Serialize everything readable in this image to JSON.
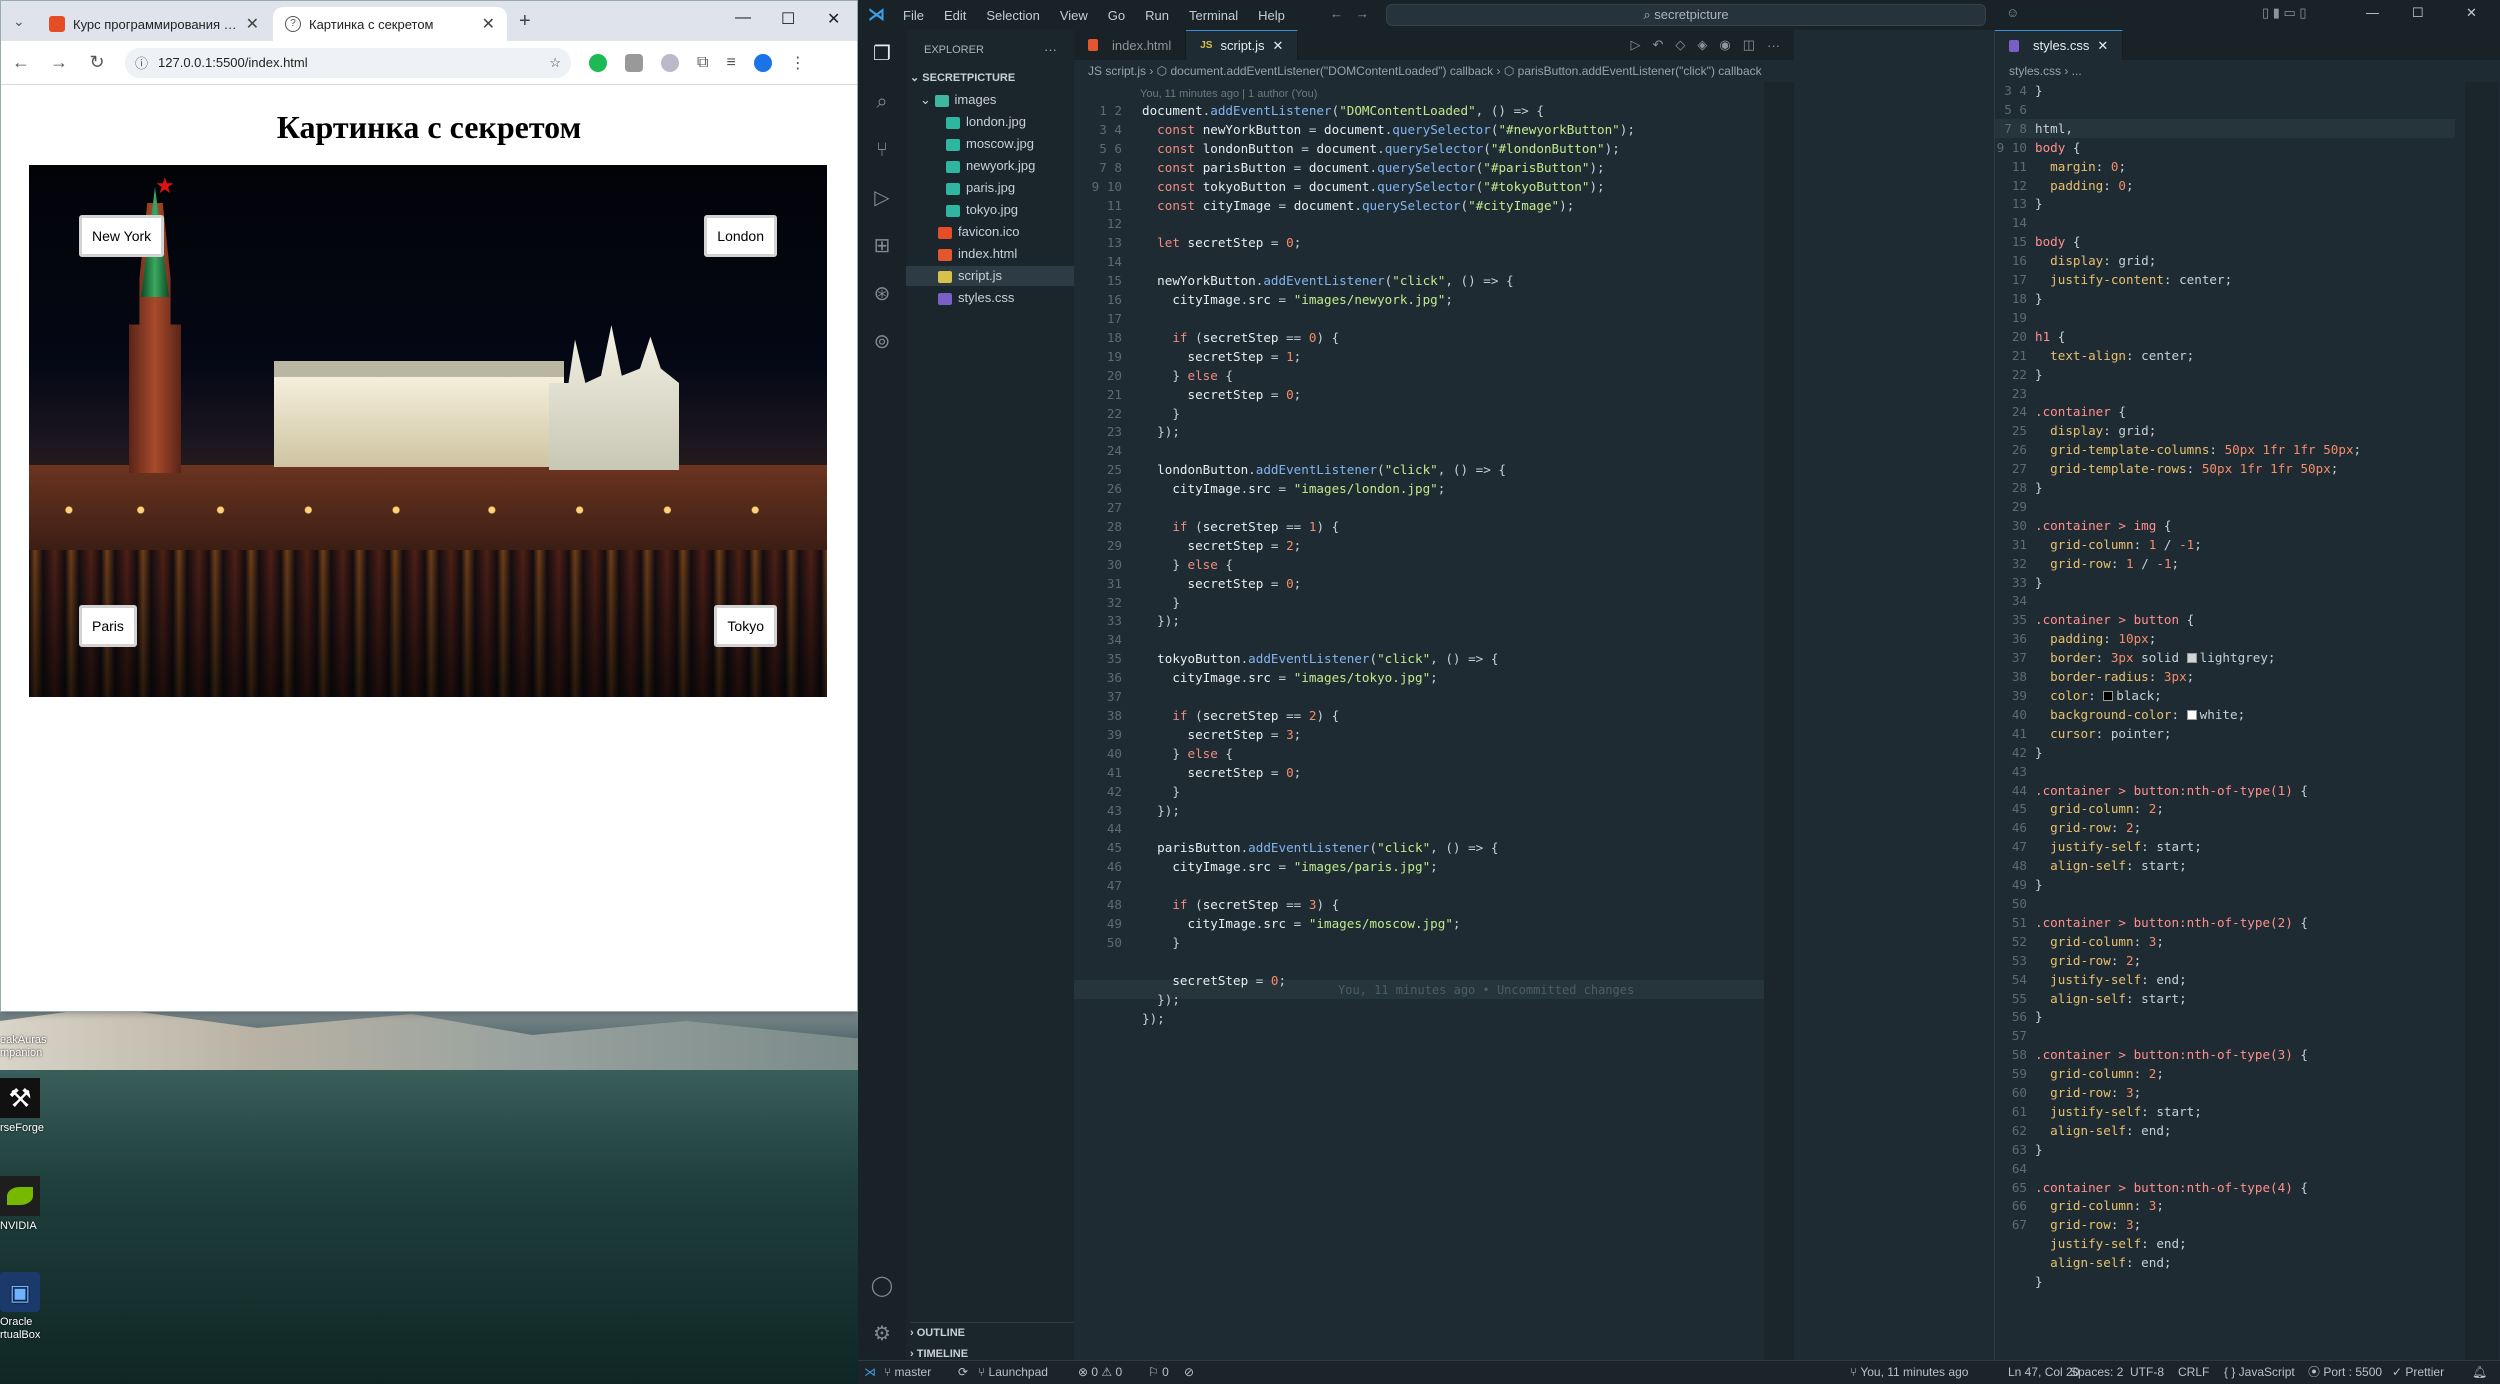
{
  "browser": {
    "tabs": [
      {
        "title": "Курс программирования | Вид"
      },
      {
        "title": "Картинка с секретом"
      }
    ],
    "url": "127.0.0.1:5500/index.html",
    "page": {
      "heading": "Картинка с секретом",
      "buttons": {
        "new_york": "New York",
        "london": "London",
        "paris": "Paris",
        "tokyo": "Tokyo"
      }
    }
  },
  "desktop": {
    "icons": [
      {
        "label": "eakAuras\nmpanion"
      },
      {
        "label": "rseForge"
      },
      {
        "label": "NVIDIA"
      },
      {
        "label": "Oracle\nrtualBox"
      }
    ]
  },
  "vscode": {
    "menu": [
      "File",
      "Edit",
      "Selection",
      "View",
      "Go",
      "Run",
      "Terminal",
      "Help"
    ],
    "search": "secretpicture",
    "explorer": {
      "title": "EXPLORER",
      "root": "SECRETPICTURE",
      "items": [
        "images",
        "london.jpg",
        "moscow.jpg",
        "newyork.jpg",
        "paris.jpg",
        "tokyo.jpg",
        "favicon.ico",
        "index.html",
        "script.js",
        "styles.css"
      ],
      "outline": "OUTLINE",
      "timeline": "TIMELINE"
    },
    "editor1": {
      "tabs": [
        "index.html",
        "script.js"
      ],
      "breadcrumb": "JS script.js › ⬡ document.addEventListener(\"DOMContentLoaded\") callback › ⬡ parisButton.addEventListener(\"click\") callback",
      "blame": "You, 11 minutes ago | 1 author (You)",
      "inline_blame": "You, 11 minutes ago • Uncommitted changes"
    },
    "editor2": {
      "tab": "styles.css",
      "breadcrumb": "styles.css › ..."
    },
    "status": {
      "branch": "master",
      "launchpad": "Launchpad",
      "problems": "0 ⚠ 0",
      "ports_count": "0",
      "blame": "You, 11 minutes ago",
      "position": "Ln 47, Col 20",
      "spaces": "Spaces: 2",
      "encoding": "UTF-8",
      "eol": "CRLF",
      "language": "{ } JavaScript",
      "port": "Port : 5500",
      "prettier": "✓ Prettier"
    }
  },
  "code_js": [
    "document.addEventListener(\"DOMContentLoaded\", () => {",
    "  const newYorkButton = document.querySelector(\"#newyorkButton\");",
    "  const londonButton = document.querySelector(\"#londonButton\");",
    "  const parisButton = document.querySelector(\"#parisButton\");",
    "  const tokyoButton = document.querySelector(\"#tokyoButton\");",
    "  const cityImage = document.querySelector(\"#cityImage\");",
    "",
    "  let secretStep = 0;",
    "",
    "  newYorkButton.addEventListener(\"click\", () => {",
    "    cityImage.src = \"images/newyork.jpg\";",
    "",
    "    if (secretStep == 0) {",
    "      secretStep = 1;",
    "    } else {",
    "      secretStep = 0;",
    "    }",
    "  });",
    "",
    "  londonButton.addEventListener(\"click\", () => {",
    "    cityImage.src = \"images/london.jpg\";",
    "",
    "    if (secretStep == 1) {",
    "      secretStep = 2;",
    "    } else {",
    "      secretStep = 0;",
    "    }",
    "  });",
    "",
    "  tokyoButton.addEventListener(\"click\", () => {",
    "    cityImage.src = \"images/tokyo.jpg\";",
    "",
    "    if (secretStep == 2) {",
    "      secretStep = 3;",
    "    } else {",
    "      secretStep = 0;",
    "    }",
    "  });",
    "",
    "  parisButton.addEventListener(\"click\", () => {",
    "    cityImage.src = \"images/paris.jpg\";",
    "",
    "    if (secretStep == 3) {",
    "      cityImage.src = \"images/moscow.jpg\";",
    "    }",
    "",
    "    secretStep = 0;",
    "  });",
    "});",
    ""
  ],
  "code_css": [
    "}",
    "",
    "html,",
    "body {",
    "  margin: 0;",
    "  padding: 0;",
    "}",
    "",
    "body {",
    "  display: grid;",
    "  justify-content: center;",
    "}",
    "",
    "h1 {",
    "  text-align: center;",
    "}",
    "",
    ".container {",
    "  display: grid;",
    "  grid-template-columns: 50px 1fr 1fr 50px;",
    "  grid-template-rows: 50px 1fr 1fr 50px;",
    "}",
    "",
    ".container > img {",
    "  grid-column: 1 / -1;",
    "  grid-row: 1 / -1;",
    "}",
    "",
    ".container > button {",
    "  padding: 10px;",
    "  border: 3px solid lightgrey;",
    "  border-radius: 3px;",
    "  color: black;",
    "  background-color: white;",
    "  cursor: pointer;",
    "}",
    "",
    ".container > button:nth-of-type(1) {",
    "  grid-column: 2;",
    "  grid-row: 2;",
    "  justify-self: start;",
    "  align-self: start;",
    "}",
    "",
    ".container > button:nth-of-type(2) {",
    "  grid-column: 3;",
    "  grid-row: 2;",
    "  justify-self: end;",
    "  align-self: start;",
    "}",
    "",
    ".container > button:nth-of-type(3) {",
    "  grid-column: 2;",
    "  grid-row: 3;",
    "  justify-self: start;",
    "  align-self: end;",
    "}",
    "",
    ".container > button:nth-of-type(4) {",
    "  grid-column: 3;",
    "  grid-row: 3;",
    "  justify-self: end;",
    "  align-self: end;",
    "}",
    ""
  ]
}
